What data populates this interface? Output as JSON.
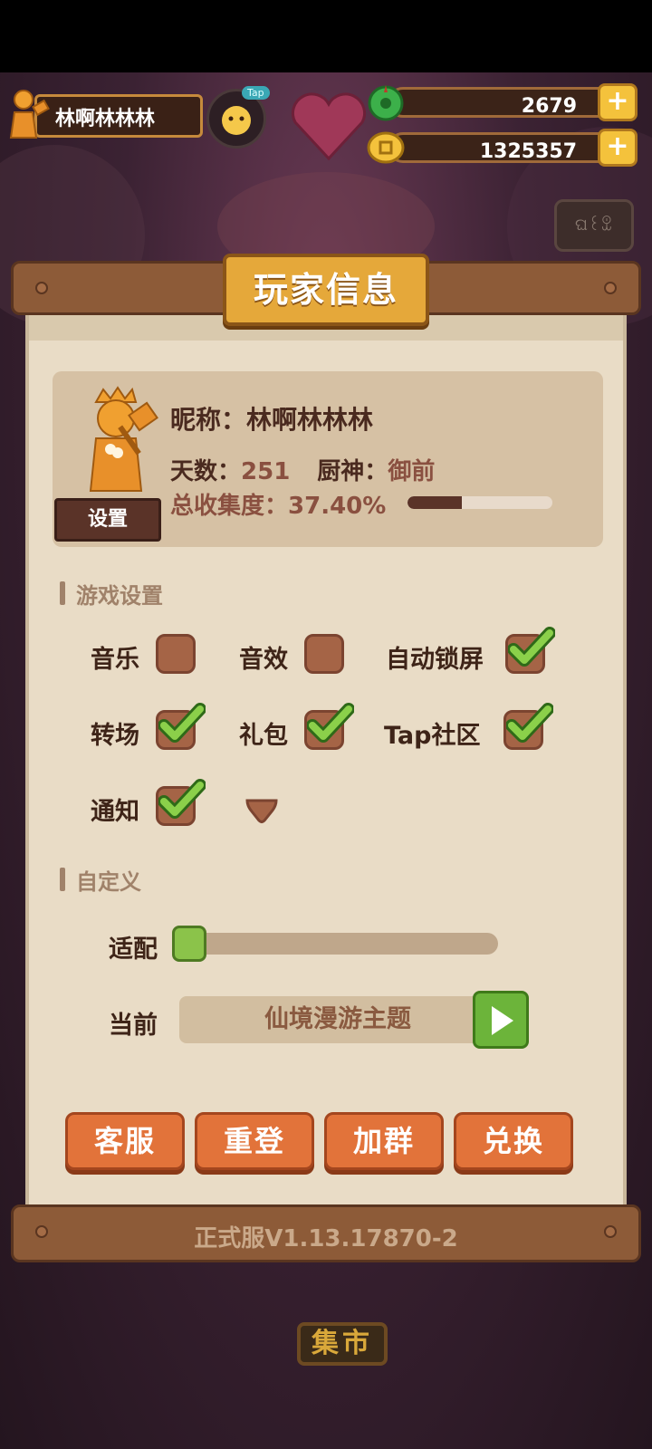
{
  "top_bar": {
    "player_name": "林啊林林林",
    "tap_label": "Tap",
    "jade_amount": "2679",
    "coin_amount": "1325357",
    "plus_glyph": "+"
  },
  "background": {
    "market_sign": "集市"
  },
  "panel": {
    "title": "玩家信息",
    "profile": {
      "settings_label": "设置",
      "nickname_label": "昵称：",
      "nickname": "林啊林林林",
      "days_label": "天数：",
      "days": "251",
      "chef_god_label": "厨神：",
      "chef_god": "御前",
      "collection_label": "总收集度：",
      "collection": "37.40%",
      "collection_fraction": 0.374
    },
    "game_settings": {
      "heading": "游戏设置",
      "options": [
        {
          "label": "音乐",
          "checked": false
        },
        {
          "label": "音效",
          "checked": false
        },
        {
          "label": "自动锁屏",
          "checked": true
        },
        {
          "label": "转场",
          "checked": true
        },
        {
          "label": "礼包",
          "checked": true
        },
        {
          "label": "Tap社区",
          "checked": true
        },
        {
          "label": "通知",
          "checked": true
        }
      ]
    },
    "custom": {
      "heading": "自定义",
      "adapt_label": "适配",
      "adapt_value": 0,
      "current_label": "当前",
      "current_theme": "仙境漫游主题"
    },
    "actions": [
      "客服",
      "重登",
      "加群",
      "兑换"
    ],
    "version": "正式服V1.13.17870-2"
  },
  "colors": {
    "accent_gold": "#e5a83a",
    "button_orange": "#e2733a",
    "check_green": "#6cb43a",
    "checkbox_brown": "#a56446"
  },
  "icons": [
    "player-statue-icon",
    "jade-icon",
    "coin-icon",
    "plus-icon",
    "checkmark-icon",
    "chevron-down-icon",
    "play-icon",
    "slider-knot-icon"
  ]
}
